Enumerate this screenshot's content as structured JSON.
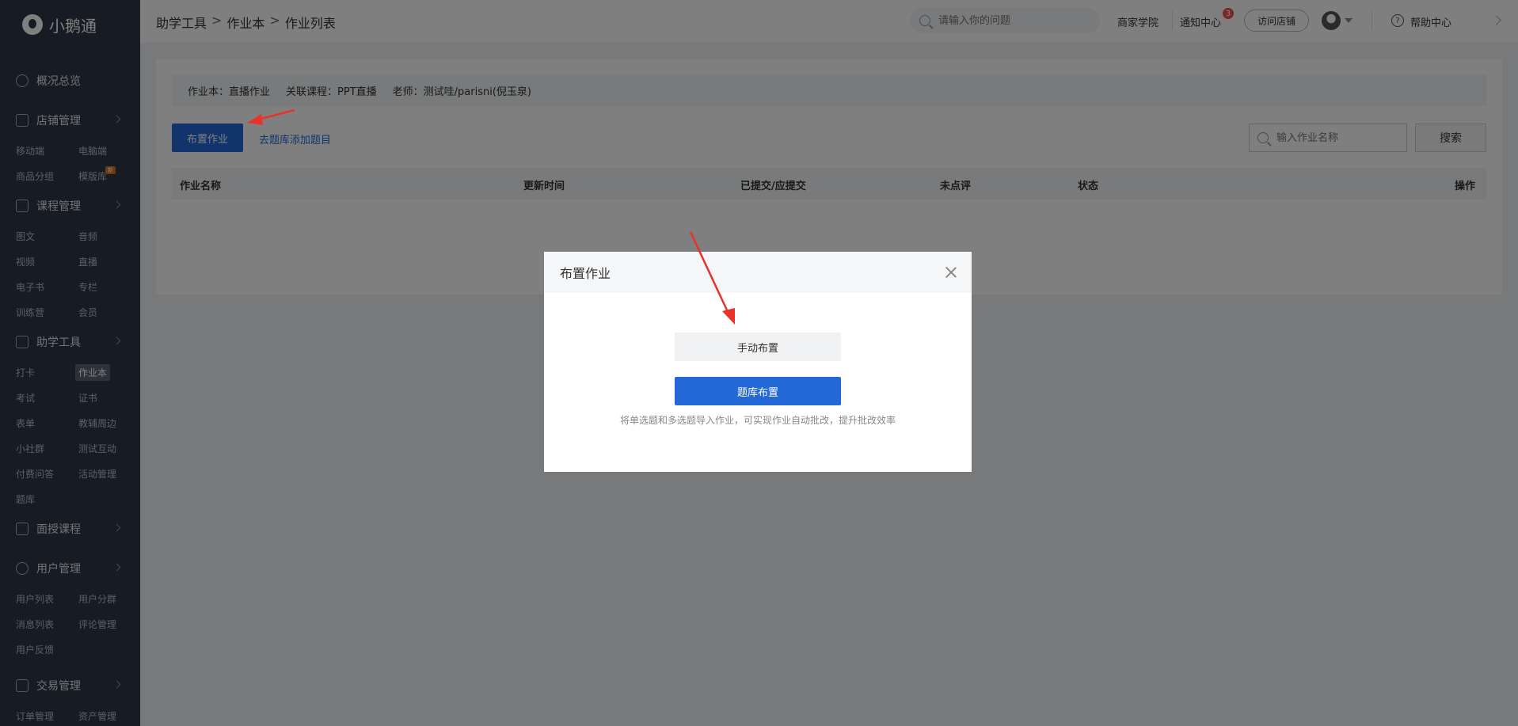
{
  "brand": {
    "name": "小鹅通"
  },
  "sidebar": {
    "overview": "概况总览",
    "sections": [
      {
        "title": "店铺管理",
        "items": [
          "移动端",
          "电脑端",
          "商品分组",
          "模版库"
        ],
        "new_tag": "新"
      },
      {
        "title": "课程管理",
        "items": [
          "图文",
          "音频",
          "视频",
          "直播",
          "电子书",
          "专栏",
          "训练营",
          "会员"
        ]
      },
      {
        "title": "助学工具",
        "items": [
          "打卡",
          "作业本",
          "考试",
          "证书",
          "表单",
          "教辅周边",
          "小社群",
          "测试互动",
          "付费问答",
          "活动管理",
          "题库"
        ],
        "active": "作业本"
      },
      {
        "title": "面授课程",
        "items": []
      },
      {
        "title": "用户管理",
        "items": [
          "用户列表",
          "用户分群",
          "消息列表",
          "评论管理",
          "用户反馈"
        ]
      },
      {
        "title": "交易管理",
        "items": [
          "订单管理",
          "资产管理"
        ]
      }
    ]
  },
  "header": {
    "breadcrumb": [
      "助学工具",
      "作业本",
      "作业列表"
    ],
    "breadcrumb_sep": ">",
    "search_placeholder": "请输入你的问题",
    "merchant_academy": "商家学院",
    "notification_center": "通知中心",
    "notification_count": "3",
    "visit_store": "访问店铺",
    "help_center": "帮助中心"
  },
  "content": {
    "info": {
      "homework_book": "作业本：直播作业",
      "course": "关联课程：PPT直播",
      "teacher": "老师：测试哇/parisni(倪玉泉)"
    },
    "assign_button": "布置作业",
    "add_from_bank_link": "去题库添加题目",
    "search_placeholder": "输入作业名称",
    "search_button": "搜索",
    "table_headers": [
      "作业名称",
      "更新时间",
      "已提交/应提交",
      "未点评",
      "状态",
      "操作"
    ]
  },
  "modal": {
    "title": "布置作业",
    "manual_button": "手动布置",
    "bank_button": "题库布置",
    "tip": "将单选题和多选题导入作业，可实现作业自动批改，提升批改效率"
  },
  "colors": {
    "primary": "#2468d8",
    "sidebar_bg": "#2f3849",
    "annotation_arrow": "#e8322a"
  }
}
